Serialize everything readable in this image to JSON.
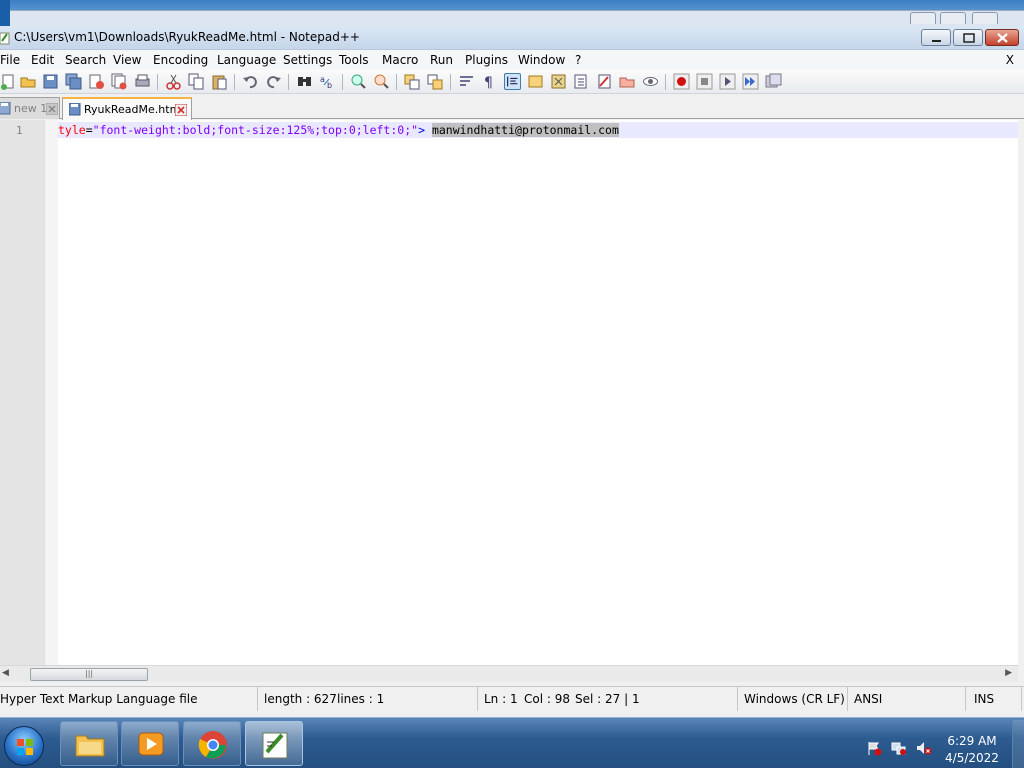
{
  "window": {
    "title": "C:\\Users\\vm1\\Downloads\\RyukReadMe.html - Notepad++"
  },
  "menu": {
    "items": [
      "File",
      "Edit",
      "Search",
      "View",
      "Encoding",
      "Language",
      "Settings",
      "Tools",
      "Macro",
      "Run",
      "Plugins",
      "Window",
      "?"
    ],
    "close_label": "X"
  },
  "tabs": [
    {
      "label": "new 1",
      "active": false
    },
    {
      "label": "RyukReadMe.html",
      "active": true
    }
  ],
  "editor": {
    "line_number": "1",
    "code": {
      "attr": "tyle",
      "eq": "=",
      "value": "\"font-weight:bold;font-size:125%;top:0;left:0;\"",
      "close": ">",
      "selected_text": "manwindhatti@protonmail.com"
    }
  },
  "status": {
    "file_type": "Hyper Text Markup Language file",
    "length": "length : 627",
    "lines": "lines : 1",
    "ln": "Ln : 1",
    "col": "Col : 98",
    "sel": "Sel : 27 | 1",
    "eol": "Windows (CR LF)",
    "encoding": "ANSI",
    "mode": "INS"
  },
  "taskbar": {
    "time": "6:29 AM",
    "date": "4/5/2022"
  },
  "colors": {
    "attr": "#ff0000",
    "string": "#8000ff",
    "tag": "#0000ff",
    "selection": "#c0c0c0",
    "current_line": "#e8e8ff"
  }
}
